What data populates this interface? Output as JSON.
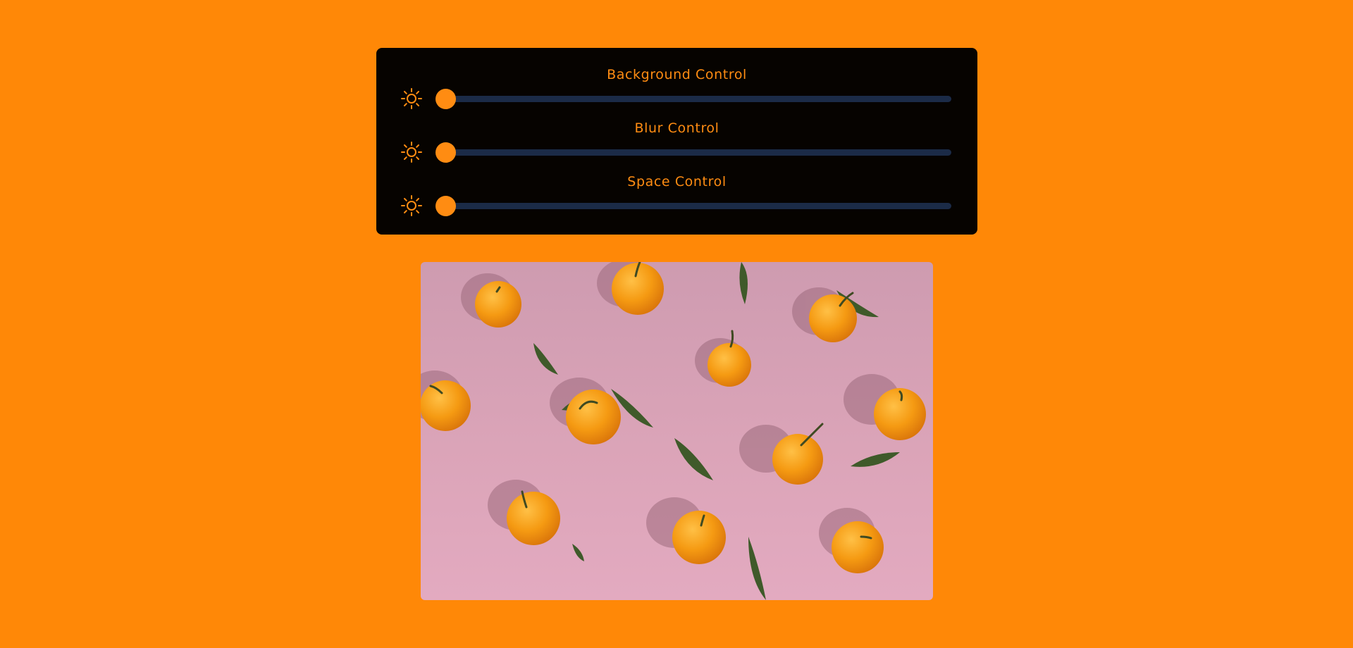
{
  "controls": [
    {
      "label": "Background Control",
      "icon": "sun-icon",
      "value": 0
    },
    {
      "label": "Blur Control",
      "icon": "sun-icon",
      "value": 0
    },
    {
      "label": "Space Control",
      "icon": "sun-icon",
      "value": 0
    }
  ],
  "photo": {
    "subject": "mandarin-oranges-on-pink-background"
  },
  "colors": {
    "page_background": "#ff8807",
    "panel_background": "#060300",
    "accent": "#ff8c12",
    "track": "#1b2b47"
  }
}
